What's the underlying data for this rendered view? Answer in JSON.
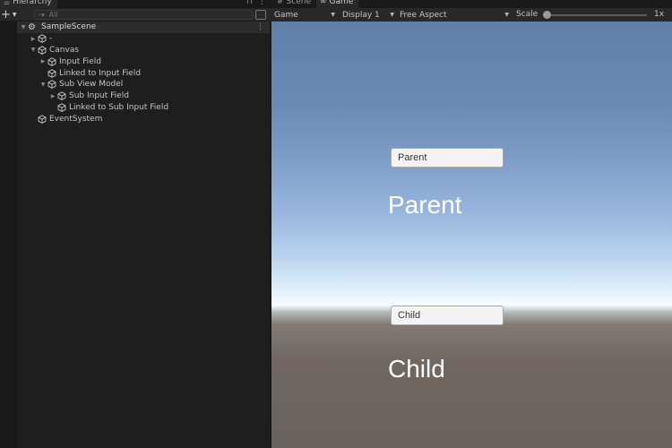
{
  "hierarchy": {
    "tab_label": "Hierarchy",
    "search_placeholder": "All",
    "scene_name": "SampleScene",
    "items": [
      {
        "label": "-",
        "depth": 1,
        "fold": "collapsed"
      },
      {
        "label": "Canvas",
        "depth": 1,
        "fold": "expanded"
      },
      {
        "label": "Input Field",
        "depth": 2,
        "fold": "collapsed"
      },
      {
        "label": "Linked to Input Field",
        "depth": 2,
        "fold": "none"
      },
      {
        "label": "Sub View Model",
        "depth": 2,
        "fold": "expanded"
      },
      {
        "label": "Sub Input Field",
        "depth": 3,
        "fold": "collapsed"
      },
      {
        "label": "Linked to Sub Input Field",
        "depth": 3,
        "fold": "none"
      },
      {
        "label": "EventSystem",
        "depth": 1,
        "fold": "none"
      }
    ]
  },
  "game_view": {
    "tabs": [
      {
        "label": "Scene",
        "icon": "hash-icon",
        "active": false
      },
      {
        "label": "Game",
        "icon": "gamepad-icon",
        "active": true
      }
    ],
    "toolbar": {
      "mode": "Game",
      "display": "Display 1",
      "aspect": "Free Aspect",
      "scale_label": "Scale",
      "scale_value": "1x",
      "scale_slider_fraction": 0.0
    },
    "content": {
      "parent_field_value": "Parent",
      "parent_label": "Parent",
      "child_field_value": "Child",
      "child_label": "Child"
    }
  },
  "colors": {
    "panel_bg": "#1e1e1e",
    "toolbar_bg": "#282828",
    "sky_top": "#607faa",
    "horizon": "#f7fdff",
    "ground": "#6c625b"
  }
}
